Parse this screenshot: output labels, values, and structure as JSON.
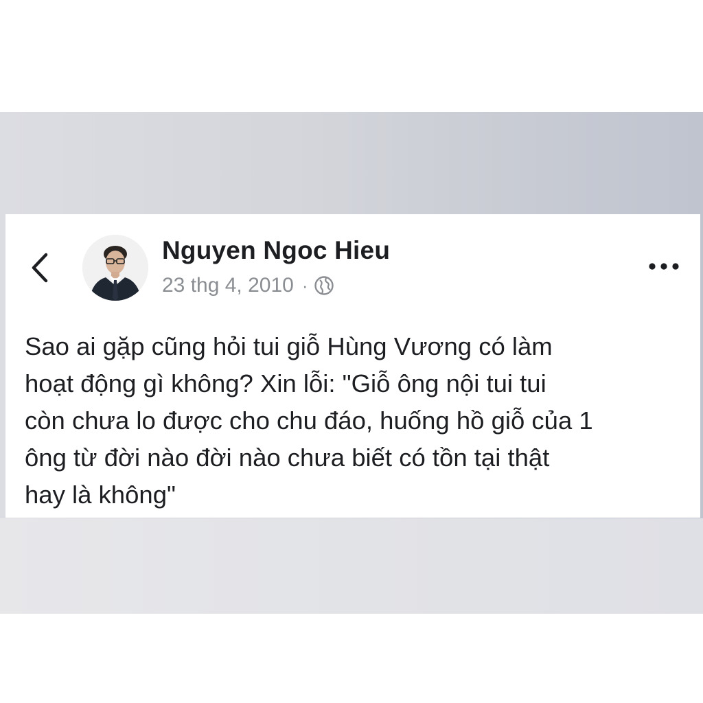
{
  "post": {
    "author_name": "Nguyen Ngoc Hieu",
    "date": "23 thg 4, 2010",
    "separator": "·",
    "audience_icon": "globe-icon",
    "back_icon": "chevron-left-icon",
    "more_icon": "more-dots-icon",
    "text_lines": [
      "Sao ai gặp cũng hỏi tui giỗ Hùng Vương có làm",
      "hoạt động gì không? Xin lỗi: \"Giỗ ông nội tui tui",
      "còn chưa lo được cho chu đáo, huống hồ giỗ của 1",
      "ông từ đời nào đời nào chưa biết có tồn tại thật",
      "hay là không\""
    ]
  },
  "colors": {
    "text_primary": "#1c1e21",
    "text_secondary": "#8a8d91",
    "card_background": "#ffffff",
    "backdrop": "#d3d5db"
  }
}
